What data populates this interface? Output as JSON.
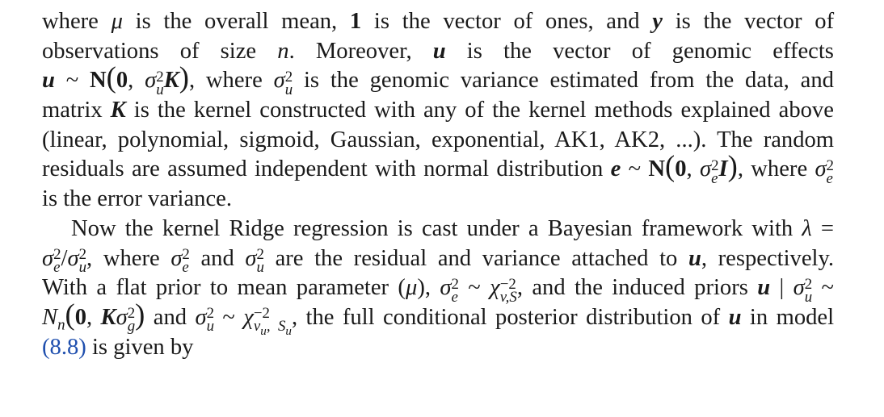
{
  "document": {
    "type": "textbook-excerpt",
    "paragraph1_lines": [
      "where μ is the overall mean, 1 is the vector of ones, and y is the vector of",
      "observations of size n. Moreover, u is the vector of genomic effects",
      "u ~ N(0, σ²_u K), where σ²_u is the genomic variance estimated from the data, and",
      "matrix K is the kernel constructed with any of the kernel methods explained above",
      "(linear, polynomial, sigmoid, Gaussian, exponential, AK1, AK2, ...). The random",
      "residuals are assumed independent with normal distribution e ~ N(0, σ²_e I), where σ²_e",
      "is the error variance."
    ],
    "paragraph2_lines": [
      "Now the kernel Ridge regression is cast under a Bayesian framework with λ =",
      "σ²_e/σ²_u, where σ²_e and σ²_u are the residual and variance attached to u, respectively.",
      "With a flat prior to mean parameter (μ), σ²_e ~ χ⁻²_{v,S}, and the induced priors u | σ²_u ~",
      "N_n(0, Kσ²_g) and σ²_u ~ χ⁻²_{v_u, S_u}, the full conditional posterior distribution of u in model",
      "(8.8) is given by"
    ],
    "equation_reference": "8.8",
    "link_color": "#1f4fae"
  }
}
